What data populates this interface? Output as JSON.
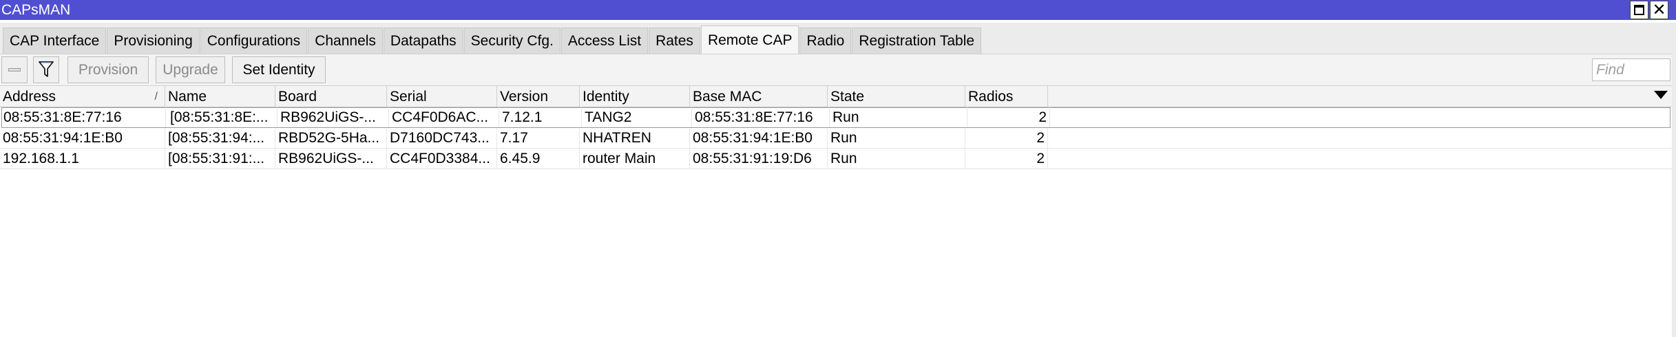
{
  "window": {
    "title": "CAPsMAN"
  },
  "tabs": [
    {
      "label": "CAP Interface",
      "active": false
    },
    {
      "label": "Provisioning",
      "active": false
    },
    {
      "label": "Configurations",
      "active": false
    },
    {
      "label": "Channels",
      "active": false
    },
    {
      "label": "Datapaths",
      "active": false
    },
    {
      "label": "Security Cfg.",
      "active": false
    },
    {
      "label": "Access List",
      "active": false
    },
    {
      "label": "Rates",
      "active": false
    },
    {
      "label": "Remote CAP",
      "active": true
    },
    {
      "label": "Radio",
      "active": false
    },
    {
      "label": "Registration Table",
      "active": false
    }
  ],
  "toolbar": {
    "minus_icon": "minus-icon",
    "filter_icon": "filter-icon",
    "provision_label": "Provision",
    "upgrade_label": "Upgrade",
    "set_identity_label": "Set Identity",
    "find_placeholder": "Find"
  },
  "table": {
    "columns": [
      "Address",
      "Name",
      "Board",
      "Serial",
      "Version",
      "Identity",
      "Base MAC",
      "State",
      "Radios"
    ],
    "sort_indicator": "/",
    "rows": [
      [
        "08:55:31:8E:77:16",
        "[08:55:31:8E:...",
        "RB962UiGS-...",
        "CC4F0D6AC...",
        "7.12.1",
        "TANG2",
        "08:55:31:8E:77:16",
        "Run",
        "2"
      ],
      [
        "08:55:31:94:1E:B0",
        "[08:55:31:94:...",
        "RBD52G-5Ha...",
        "D7160DC743...",
        "7.17",
        "NHATREN",
        "08:55:31:94:1E:B0",
        "Run",
        "2"
      ],
      [
        "192.168.1.1",
        "[08:55:31:91:...",
        "RB962UiGS-...",
        "CC4F0D3384...",
        "6.45.9",
        "router Main",
        "08:55:31:91:19:D6",
        "Run",
        "2"
      ]
    ]
  }
}
